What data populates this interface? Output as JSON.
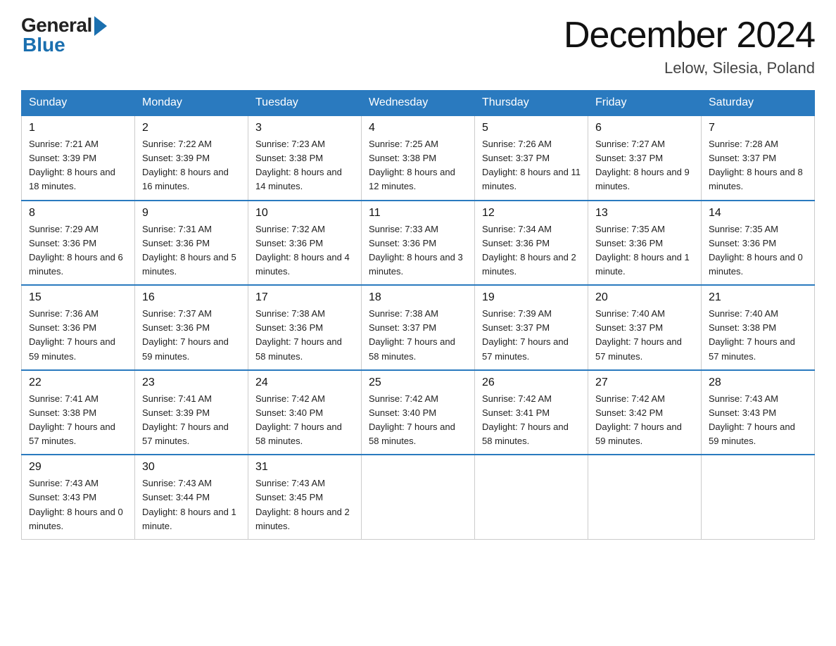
{
  "logo": {
    "general": "General",
    "blue": "Blue"
  },
  "title": "December 2024",
  "location": "Lelow, Silesia, Poland",
  "days_of_week": [
    "Sunday",
    "Monday",
    "Tuesday",
    "Wednesday",
    "Thursday",
    "Friday",
    "Saturday"
  ],
  "weeks": [
    [
      {
        "num": "1",
        "sunrise": "Sunrise: 7:21 AM",
        "sunset": "Sunset: 3:39 PM",
        "daylight": "Daylight: 8 hours and 18 minutes."
      },
      {
        "num": "2",
        "sunrise": "Sunrise: 7:22 AM",
        "sunset": "Sunset: 3:39 PM",
        "daylight": "Daylight: 8 hours and 16 minutes."
      },
      {
        "num": "3",
        "sunrise": "Sunrise: 7:23 AM",
        "sunset": "Sunset: 3:38 PM",
        "daylight": "Daylight: 8 hours and 14 minutes."
      },
      {
        "num": "4",
        "sunrise": "Sunrise: 7:25 AM",
        "sunset": "Sunset: 3:38 PM",
        "daylight": "Daylight: 8 hours and 12 minutes."
      },
      {
        "num": "5",
        "sunrise": "Sunrise: 7:26 AM",
        "sunset": "Sunset: 3:37 PM",
        "daylight": "Daylight: 8 hours and 11 minutes."
      },
      {
        "num": "6",
        "sunrise": "Sunrise: 7:27 AM",
        "sunset": "Sunset: 3:37 PM",
        "daylight": "Daylight: 8 hours and 9 minutes."
      },
      {
        "num": "7",
        "sunrise": "Sunrise: 7:28 AM",
        "sunset": "Sunset: 3:37 PM",
        "daylight": "Daylight: 8 hours and 8 minutes."
      }
    ],
    [
      {
        "num": "8",
        "sunrise": "Sunrise: 7:29 AM",
        "sunset": "Sunset: 3:36 PM",
        "daylight": "Daylight: 8 hours and 6 minutes."
      },
      {
        "num": "9",
        "sunrise": "Sunrise: 7:31 AM",
        "sunset": "Sunset: 3:36 PM",
        "daylight": "Daylight: 8 hours and 5 minutes."
      },
      {
        "num": "10",
        "sunrise": "Sunrise: 7:32 AM",
        "sunset": "Sunset: 3:36 PM",
        "daylight": "Daylight: 8 hours and 4 minutes."
      },
      {
        "num": "11",
        "sunrise": "Sunrise: 7:33 AM",
        "sunset": "Sunset: 3:36 PM",
        "daylight": "Daylight: 8 hours and 3 minutes."
      },
      {
        "num": "12",
        "sunrise": "Sunrise: 7:34 AM",
        "sunset": "Sunset: 3:36 PM",
        "daylight": "Daylight: 8 hours and 2 minutes."
      },
      {
        "num": "13",
        "sunrise": "Sunrise: 7:35 AM",
        "sunset": "Sunset: 3:36 PM",
        "daylight": "Daylight: 8 hours and 1 minute."
      },
      {
        "num": "14",
        "sunrise": "Sunrise: 7:35 AM",
        "sunset": "Sunset: 3:36 PM",
        "daylight": "Daylight: 8 hours and 0 minutes."
      }
    ],
    [
      {
        "num": "15",
        "sunrise": "Sunrise: 7:36 AM",
        "sunset": "Sunset: 3:36 PM",
        "daylight": "Daylight: 7 hours and 59 minutes."
      },
      {
        "num": "16",
        "sunrise": "Sunrise: 7:37 AM",
        "sunset": "Sunset: 3:36 PM",
        "daylight": "Daylight: 7 hours and 59 minutes."
      },
      {
        "num": "17",
        "sunrise": "Sunrise: 7:38 AM",
        "sunset": "Sunset: 3:36 PM",
        "daylight": "Daylight: 7 hours and 58 minutes."
      },
      {
        "num": "18",
        "sunrise": "Sunrise: 7:38 AM",
        "sunset": "Sunset: 3:37 PM",
        "daylight": "Daylight: 7 hours and 58 minutes."
      },
      {
        "num": "19",
        "sunrise": "Sunrise: 7:39 AM",
        "sunset": "Sunset: 3:37 PM",
        "daylight": "Daylight: 7 hours and 57 minutes."
      },
      {
        "num": "20",
        "sunrise": "Sunrise: 7:40 AM",
        "sunset": "Sunset: 3:37 PM",
        "daylight": "Daylight: 7 hours and 57 minutes."
      },
      {
        "num": "21",
        "sunrise": "Sunrise: 7:40 AM",
        "sunset": "Sunset: 3:38 PM",
        "daylight": "Daylight: 7 hours and 57 minutes."
      }
    ],
    [
      {
        "num": "22",
        "sunrise": "Sunrise: 7:41 AM",
        "sunset": "Sunset: 3:38 PM",
        "daylight": "Daylight: 7 hours and 57 minutes."
      },
      {
        "num": "23",
        "sunrise": "Sunrise: 7:41 AM",
        "sunset": "Sunset: 3:39 PM",
        "daylight": "Daylight: 7 hours and 57 minutes."
      },
      {
        "num": "24",
        "sunrise": "Sunrise: 7:42 AM",
        "sunset": "Sunset: 3:40 PM",
        "daylight": "Daylight: 7 hours and 58 minutes."
      },
      {
        "num": "25",
        "sunrise": "Sunrise: 7:42 AM",
        "sunset": "Sunset: 3:40 PM",
        "daylight": "Daylight: 7 hours and 58 minutes."
      },
      {
        "num": "26",
        "sunrise": "Sunrise: 7:42 AM",
        "sunset": "Sunset: 3:41 PM",
        "daylight": "Daylight: 7 hours and 58 minutes."
      },
      {
        "num": "27",
        "sunrise": "Sunrise: 7:42 AM",
        "sunset": "Sunset: 3:42 PM",
        "daylight": "Daylight: 7 hours and 59 minutes."
      },
      {
        "num": "28",
        "sunrise": "Sunrise: 7:43 AM",
        "sunset": "Sunset: 3:43 PM",
        "daylight": "Daylight: 7 hours and 59 minutes."
      }
    ],
    [
      {
        "num": "29",
        "sunrise": "Sunrise: 7:43 AM",
        "sunset": "Sunset: 3:43 PM",
        "daylight": "Daylight: 8 hours and 0 minutes."
      },
      {
        "num": "30",
        "sunrise": "Sunrise: 7:43 AM",
        "sunset": "Sunset: 3:44 PM",
        "daylight": "Daylight: 8 hours and 1 minute."
      },
      {
        "num": "31",
        "sunrise": "Sunrise: 7:43 AM",
        "sunset": "Sunset: 3:45 PM",
        "daylight": "Daylight: 8 hours and 2 minutes."
      },
      null,
      null,
      null,
      null
    ]
  ]
}
